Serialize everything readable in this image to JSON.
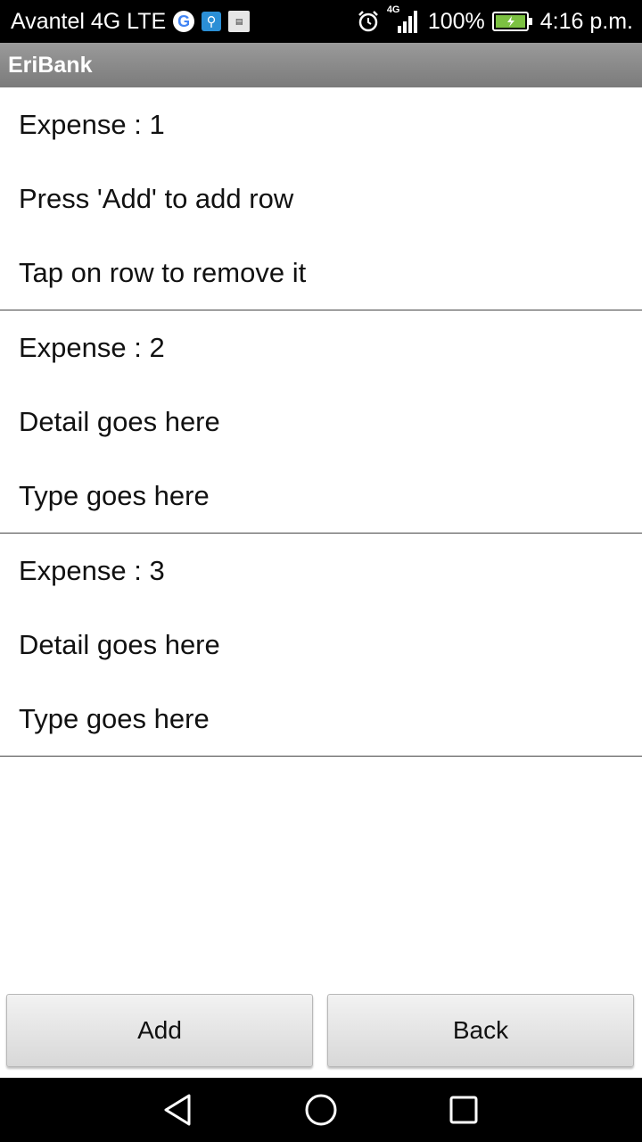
{
  "status_bar": {
    "carrier": "Avantel 4G LTE",
    "network_type": "4G",
    "battery_percent": "100%",
    "time": "4:16 p.m.",
    "icons": [
      "google-icon",
      "usb-icon",
      "sim-icon",
      "alarm-icon",
      "signal-icon",
      "battery-icon"
    ]
  },
  "app": {
    "title": "EriBank"
  },
  "expenses": [
    {
      "title": "Expense : 1",
      "detail": "Press 'Add' to add row",
      "type": "Tap on row to remove it"
    },
    {
      "title": "Expense : 2",
      "detail": "Detail goes here",
      "type": "Type goes here"
    },
    {
      "title": "Expense : 3",
      "detail": "Detail goes here",
      "type": "Type goes here"
    }
  ],
  "buttons": {
    "add_label": "Add",
    "back_label": "Back"
  },
  "nav_bar": {
    "icons": [
      "back-triangle-icon",
      "home-circle-icon",
      "recents-square-icon"
    ]
  },
  "colors": {
    "title_bar": "#8a8a8a",
    "battery_fill": "#7cc142",
    "usb_icon": "#2b8fd6"
  }
}
